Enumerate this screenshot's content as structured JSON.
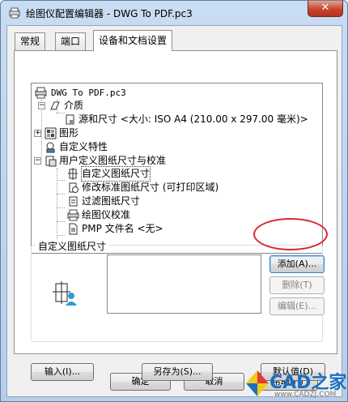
{
  "window": {
    "title": "绘图仪配置编辑器 - DWG To PDF.pc3",
    "close_symbol": "✕"
  },
  "tabs": [
    {
      "label": "常规"
    },
    {
      "label": "端口"
    },
    {
      "label": "设备和文档设置"
    }
  ],
  "tree": {
    "root": "DWG To PDF.pc3",
    "media": "介质",
    "source_size": "源和尺寸 <大小: ISO A4 (210.00 x 297.00 毫米)>",
    "graphics": "图形",
    "custom_props": "自定义特性",
    "user_paper": "用户定义图纸尺寸与校准",
    "custom_paper": "自定义图纸尺寸",
    "modify_std": "修改标准图纸尺寸 (可打印区域)",
    "filter_paper": "过滤图纸尺寸",
    "plotter_calib": "绘图仪校准",
    "pmp_file": "PMP 文件名 <无>"
  },
  "group": {
    "title": "自定义图纸尺寸",
    "add_label": "添加(A)...",
    "delete_label": "删除(T)",
    "edit_label": "编辑(E)..."
  },
  "bottom": {
    "import_label": "输入(I)...",
    "save_as_label": "另存为(S)...",
    "defaults_label": "默认值(D)"
  },
  "footer": {
    "ok_label": "确定",
    "cancel_label": "取消",
    "help_label": "帮助(H)"
  },
  "watermark": {
    "text": "CAD之家",
    "url": "www.CADZJ.COM"
  }
}
